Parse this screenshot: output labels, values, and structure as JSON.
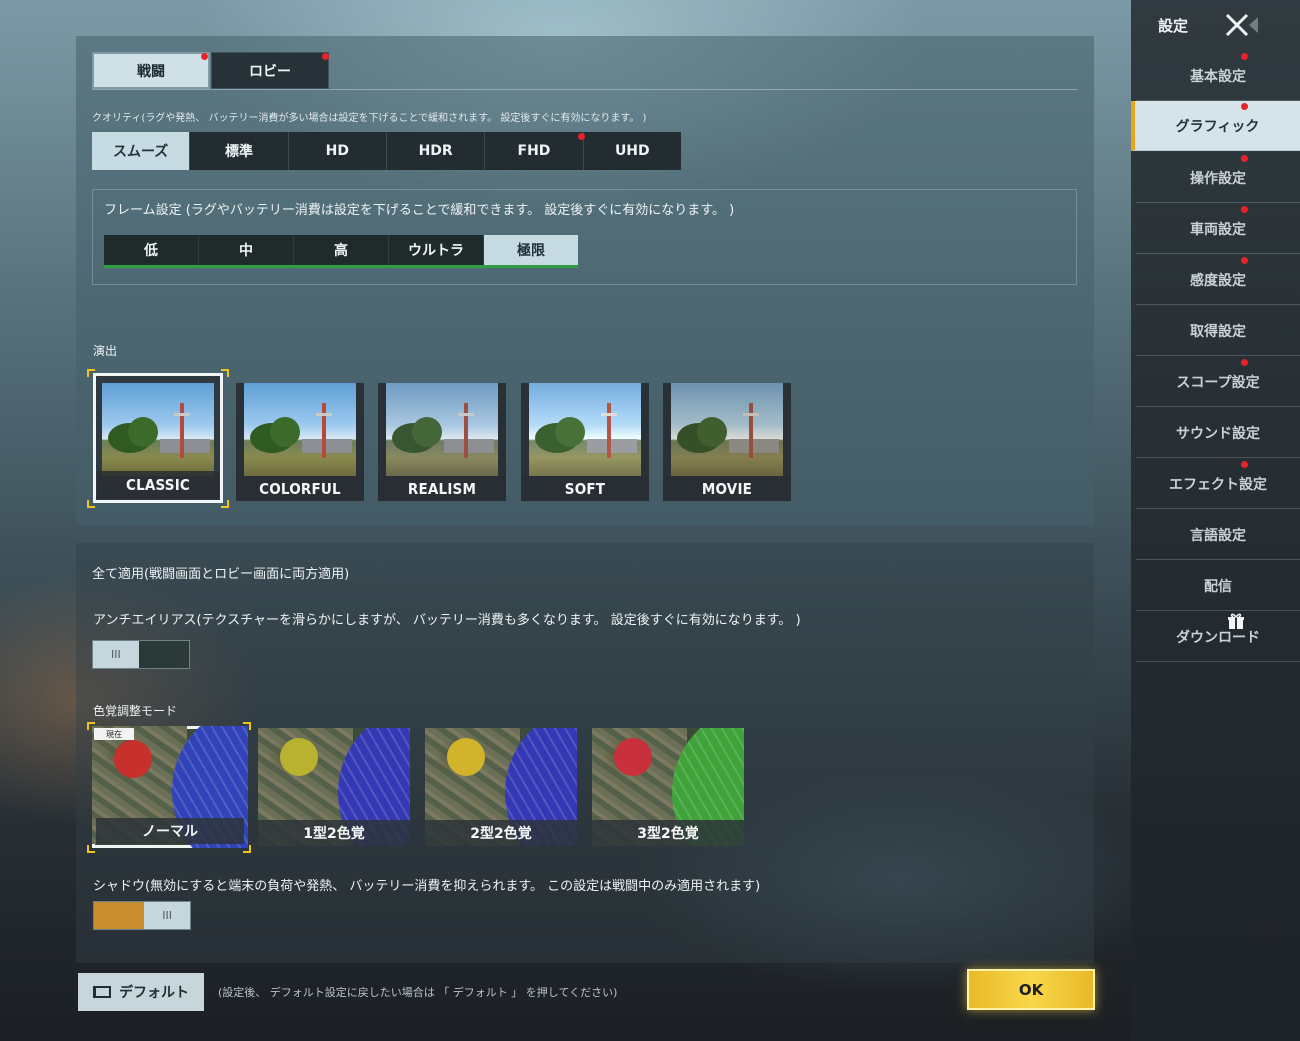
{
  "tabs": [
    {
      "label": "戦闘"
    },
    {
      "label": "ロビー"
    }
  ],
  "quality": {
    "description": "クオリティ(ラグや発熱、 バッテリー消費が多い場合は設定を下げることで緩和されます。 設定後すぐに有効になります。 )",
    "options": [
      "スムーズ",
      "標準",
      "HD",
      "HDR",
      "FHD",
      "UHD"
    ],
    "selected": "スムーズ"
  },
  "frame": {
    "description": "フレーム設定 (ラグやバッテリー消費は設定を下げることで緩和できます。 設定後すぐに有効になります。 )",
    "options": [
      "低",
      "中",
      "高",
      "ウルトラ",
      "極限"
    ],
    "selected": "極限"
  },
  "presentation": {
    "label": "演出",
    "options": [
      "CLASSIC",
      "COLORFUL",
      "REALISM",
      "SOFT",
      "MOVIE"
    ],
    "selected": "CLASSIC"
  },
  "apply_all": "全て適用(戦闘画面とロビー画面に両方適用)",
  "antialias": {
    "label": "アンチエイリアス(テクスチャーを滑らかにしますが、 バッテリー消費も多くなります。 設定後すぐに有効になります。 )",
    "handle": "III"
  },
  "colorblind": {
    "label": "色覚調整モード",
    "current_tag": "現在",
    "options": [
      "ノーマル",
      "1型2色覚",
      "2型2色覚",
      "3型2色覚"
    ],
    "selected": "ノーマル"
  },
  "shadow": {
    "label": "シャドウ(無効にすると端末の負荷や発熱、 バッテリー消費を抑えられます。 この設定は戦闘中のみ適用されます)",
    "handle": "III"
  },
  "footer": {
    "default_label": "デフォルト",
    "hint": "(設定後、 デフォルト設定に戻したい場合は 「 デフォルト 」 を押してください)",
    "ok_label": "OK"
  },
  "sidebar": {
    "title": "設定",
    "items": [
      {
        "label": "基本設定"
      },
      {
        "label": "グラフィック"
      },
      {
        "label": "操作設定"
      },
      {
        "label": "車両設定"
      },
      {
        "label": "感度設定"
      },
      {
        "label": "取得設定"
      },
      {
        "label": "スコープ設定"
      },
      {
        "label": "サウンド設定"
      },
      {
        "label": "エフェクト設定"
      },
      {
        "label": "言語設定"
      },
      {
        "label": "配信"
      },
      {
        "label": "ダウンロード"
      }
    ],
    "active": "グラフィック"
  },
  "colors": {
    "accent_yellow": "#f0c419",
    "notification_red": "#e8222a",
    "frame_green": "#2ea043"
  }
}
